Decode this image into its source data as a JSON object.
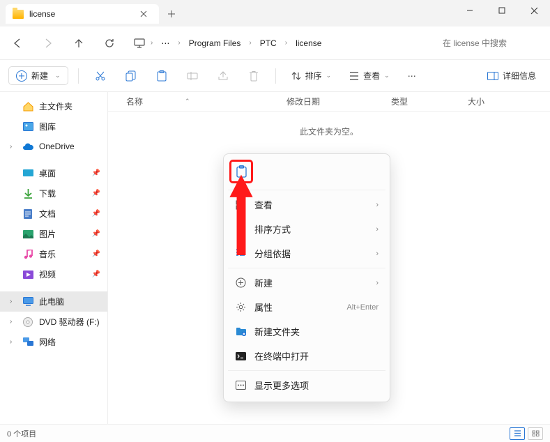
{
  "tab": {
    "title": "license"
  },
  "breadcrumb": {
    "ellipsis": "⋯",
    "items": [
      "Program Files",
      "PTC",
      "license"
    ]
  },
  "search": {
    "placeholder": "在 license 中搜索"
  },
  "toolbar": {
    "new_label": "新建",
    "sort_label": "排序",
    "view_label": "查看",
    "details_label": "详细信息"
  },
  "columns": {
    "name": "名称",
    "date": "修改日期",
    "type": "类型",
    "size": "大小"
  },
  "empty_message": "此文件夹为空。",
  "sidebar": {
    "home": "主文件夹",
    "gallery": "图库",
    "onedrive": "OneDrive",
    "desktop": "桌面",
    "downloads": "下载",
    "documents": "文档",
    "pictures": "图片",
    "music": "音乐",
    "videos": "视频",
    "this_pc": "此电脑",
    "dvd": "DVD 驱动器 (F:)",
    "network": "网络"
  },
  "context_menu": {
    "view": "查看",
    "sort": "排序方式",
    "group": "分组依据",
    "new": "新建",
    "properties": "属性",
    "properties_shortcut": "Alt+Enter",
    "new_folder": "新建文件夹",
    "terminal": "在终端中打开",
    "more": "显示更多选项"
  },
  "status": {
    "items": "0 个项目"
  }
}
